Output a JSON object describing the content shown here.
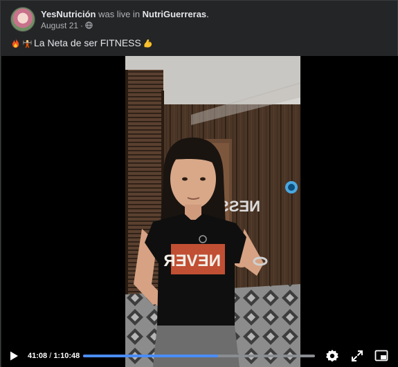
{
  "post": {
    "author": "YesNutrición",
    "action": " was live in ",
    "group": "NutriGuerreras",
    "dot": ".",
    "date": "August 21",
    "date_sep": " · ",
    "caption": "La Neta de ser FITNESS",
    "caption_emojis_before": [
      "fire-emoji",
      "weightlifter-emoji"
    ],
    "caption_emoji_after": "flexed-biceps-emoji",
    "privacy_icon": "globe-icon"
  },
  "video": {
    "current_time": "41:08",
    "time_separator": " / ",
    "duration": "1:10:48",
    "progress_fraction": 0.581,
    "shirt_text": "NEVER",
    "wall_sign_text": "NESS",
    "colors": {
      "progress": "#4a8df8",
      "track": "#8a8d91"
    },
    "controls": [
      "play-icon",
      "settings-gear-icon",
      "fullscreen-expand-icon",
      "picture-in-picture-icon"
    ]
  }
}
